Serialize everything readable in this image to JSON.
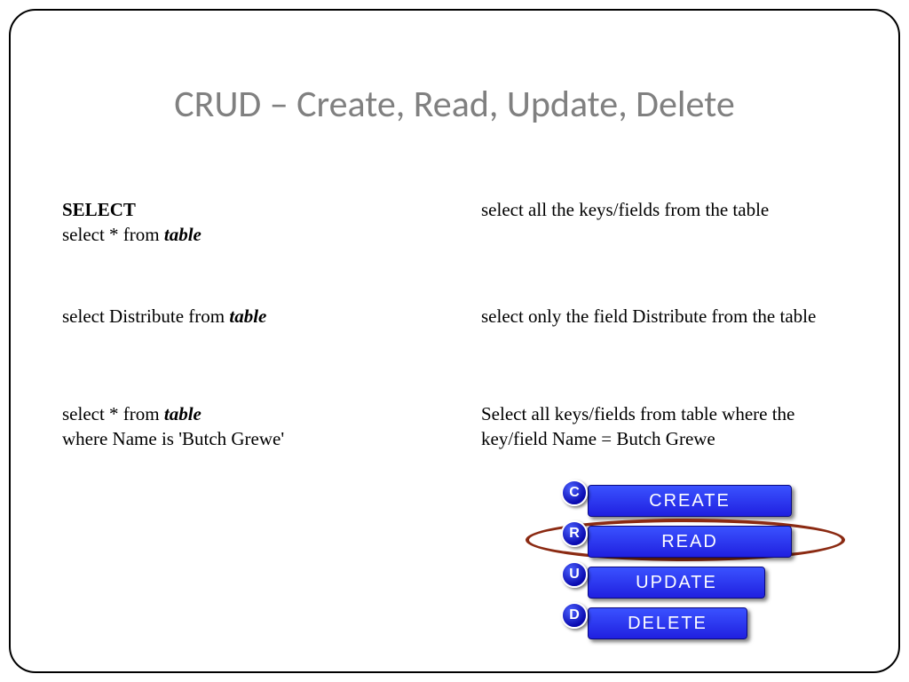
{
  "title": "CRUD – Create, Read, Update, Delete",
  "left": {
    "select_keyword": "SELECT",
    "row1a": "select * from ",
    "row1b": "table",
    "row2a": "select Distribute from ",
    "row2b": "table",
    "row3a": "select * from ",
    "row3b": "table",
    "row3c": "where Name is 'Butch Grewe'"
  },
  "right": {
    "row1": "select all the keys/fields from the table",
    "row2": "select only the field Distribute from the table",
    "row3a": "Select all keys/fields from table where the",
    "row3b": "key/field Name = Butch Grewe"
  },
  "crud": {
    "create": {
      "badge": "C",
      "label": "CREATE"
    },
    "read": {
      "badge": "R",
      "label": "READ"
    },
    "update": {
      "badge": "U",
      "label": "UPDATE"
    },
    "delete": {
      "badge": "D",
      "label": "DELETE"
    }
  }
}
